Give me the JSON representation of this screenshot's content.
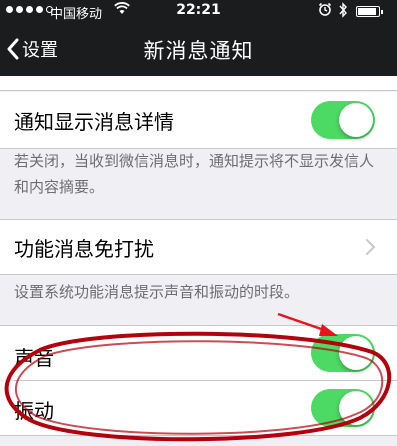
{
  "status_bar": {
    "carrier": "中国移动",
    "time": "22:21",
    "battery_level": 0.9
  },
  "nav": {
    "back_label": "设置",
    "title": "新消息通知"
  },
  "sections": {
    "detail": {
      "label": "通知显示消息详情",
      "enabled": true,
      "footer": "若关闭，当收到微信消息时，通知提示将不显示发信人和内容摘要。"
    },
    "dnd": {
      "label": "功能消息免打扰",
      "footer": "设置系统功能消息提示声音和振动的时段。"
    },
    "sound": {
      "label": "声音",
      "enabled": true
    },
    "vibrate": {
      "label": "振动",
      "enabled": true
    }
  },
  "colors": {
    "toggle_on": "#4cd964",
    "annotation": "#b3000c"
  },
  "icons": [
    "signal-dots-icon",
    "wifi-icon",
    "alarm-clock-icon",
    "bluetooth-icon",
    "battery-icon",
    "back-chevron-icon",
    "chevron-right-icon"
  ]
}
